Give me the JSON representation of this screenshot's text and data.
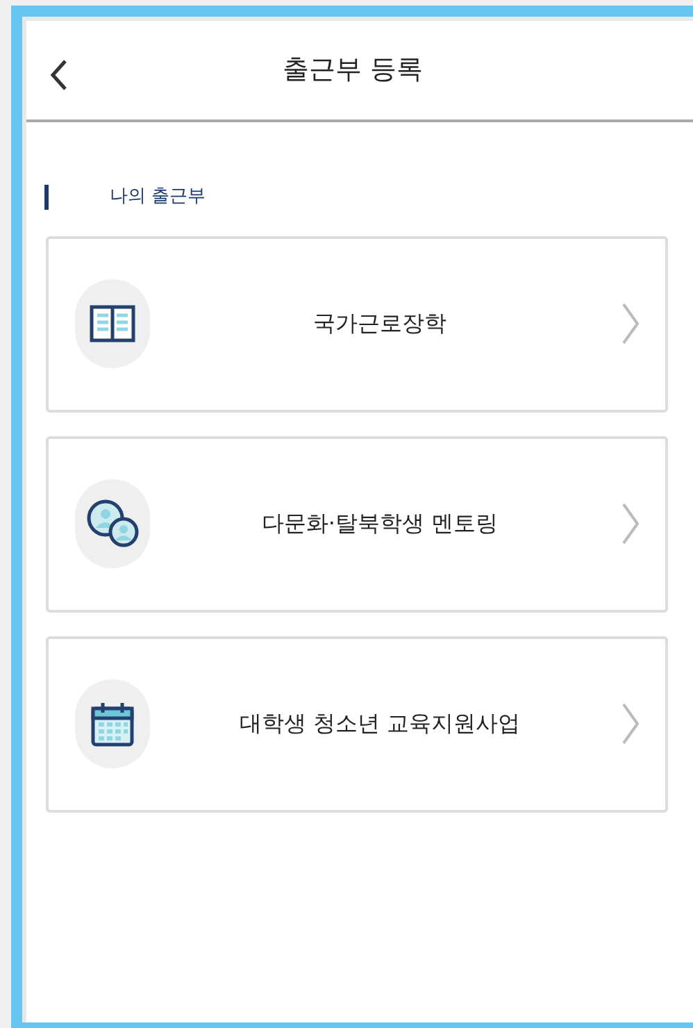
{
  "header": {
    "title": "출근부 등록"
  },
  "section": {
    "label": "나의 출근부"
  },
  "items": [
    {
      "kind": "book",
      "label": "국가근로장학"
    },
    {
      "kind": "chat",
      "label": "다문화·탈북학생 멘토링"
    },
    {
      "kind": "calendar",
      "label": "대학생 청소년 교육지원사업"
    }
  ]
}
